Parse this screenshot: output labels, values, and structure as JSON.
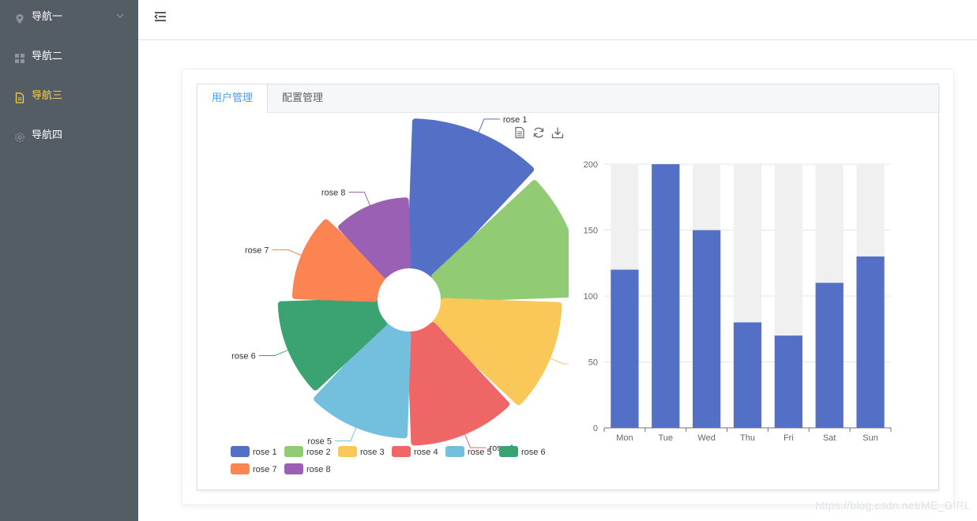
{
  "sidebar": {
    "items": [
      {
        "label": "导航一",
        "icon": "location-icon",
        "active": false,
        "has_submenu": true
      },
      {
        "label": "导航二",
        "icon": "menu-grid-icon",
        "active": false
      },
      {
        "label": "导航三",
        "icon": "document-icon",
        "active": true
      },
      {
        "label": "导航四",
        "icon": "setting-icon",
        "active": false
      }
    ],
    "colors": {
      "background": "#545c64",
      "text": "#ffffff",
      "active_text": "#ffd04b"
    }
  },
  "header": {
    "toggle_icon": "fold-menu-icon"
  },
  "tabs": [
    {
      "label": "用户管理",
      "active": true
    },
    {
      "label": "配置管理",
      "active": false
    }
  ],
  "toolbox": [
    {
      "name": "data-view-icon"
    },
    {
      "name": "restore-icon"
    },
    {
      "name": "save-image-icon"
    }
  ],
  "watermark": "https://blog.csdn.net/ME_GIRL",
  "chart_data": [
    {
      "type": "pie",
      "rose_type": "radius",
      "categories": [
        "rose 1",
        "rose 2",
        "rose 3",
        "rose 4",
        "rose 5",
        "rose 6",
        "rose 7",
        "rose 8"
      ],
      "values": [
        40,
        38,
        32,
        30,
        28,
        26,
        22,
        18
      ],
      "colors": [
        "#5470c6",
        "#91cc75",
        "#fac858",
        "#ee6666",
        "#73c0de",
        "#3ba272",
        "#fc8452",
        "#9a60b4"
      ],
      "legend_position": "bottom-left",
      "title": ""
    },
    {
      "type": "bar",
      "categories": [
        "Mon",
        "Tue",
        "Wed",
        "Thu",
        "Fri",
        "Sat",
        "Sun"
      ],
      "values": [
        120,
        200,
        150,
        80,
        70,
        110,
        130
      ],
      "background_bar": 200,
      "ylim": [
        0,
        200
      ],
      "yticks": [
        0,
        50,
        100,
        150,
        200
      ],
      "color": "#5470c6",
      "background_color": "#f0f0f0",
      "grid": true,
      "xlabel": "",
      "ylabel": "",
      "title": ""
    }
  ]
}
